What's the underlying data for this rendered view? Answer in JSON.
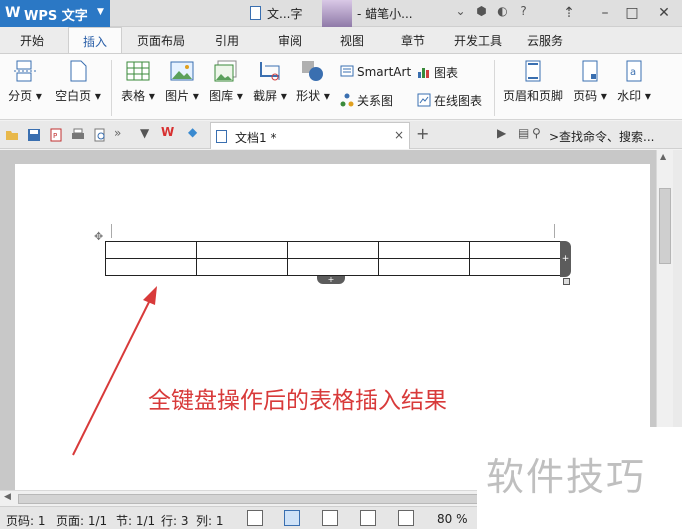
{
  "titlebar": {
    "app_name": "WPS 文字",
    "doc_title": "文...字",
    "user_name": "- 蜡笔小...",
    "help": "?"
  },
  "menu_tabs": [
    "开始",
    "插入",
    "页面布局",
    "引用",
    "审阅",
    "视图",
    "章节",
    "开发工具",
    "云服务"
  ],
  "active_tab": "插入",
  "ribbon": {
    "page_break": "分页",
    "blank_page": "空白页",
    "table": "表格",
    "picture": "图片",
    "gallery": "图库",
    "screenshot": "截屏",
    "shapes": "形状",
    "smartart": "SmartArt",
    "chart": "图表",
    "relation_chart": "关系图",
    "online_chart": "在线图表",
    "header_footer": "页眉和页脚",
    "page_number": "页码",
    "watermark": "水印"
  },
  "toolbar": {
    "doc_tab": "文档1 *",
    "close": "×",
    "new_tab": "+",
    "search_placeholder": ">查找命令、搜索..."
  },
  "document": {
    "table_rows": 2,
    "table_cols": 5
  },
  "annotation": "全键盘操作后的表格插入结果",
  "watermark_text": "软件技巧",
  "statusbar": {
    "page_num": "页码: 1",
    "page_count": "页面: 1/1",
    "section": "节: 1/1",
    "row": "行: 3",
    "col": "列: 1",
    "zoom": "80 %"
  },
  "colors": {
    "accent": "#2b78c5",
    "annotation": "#d83a3a",
    "watermark": "#bfbfbf"
  }
}
